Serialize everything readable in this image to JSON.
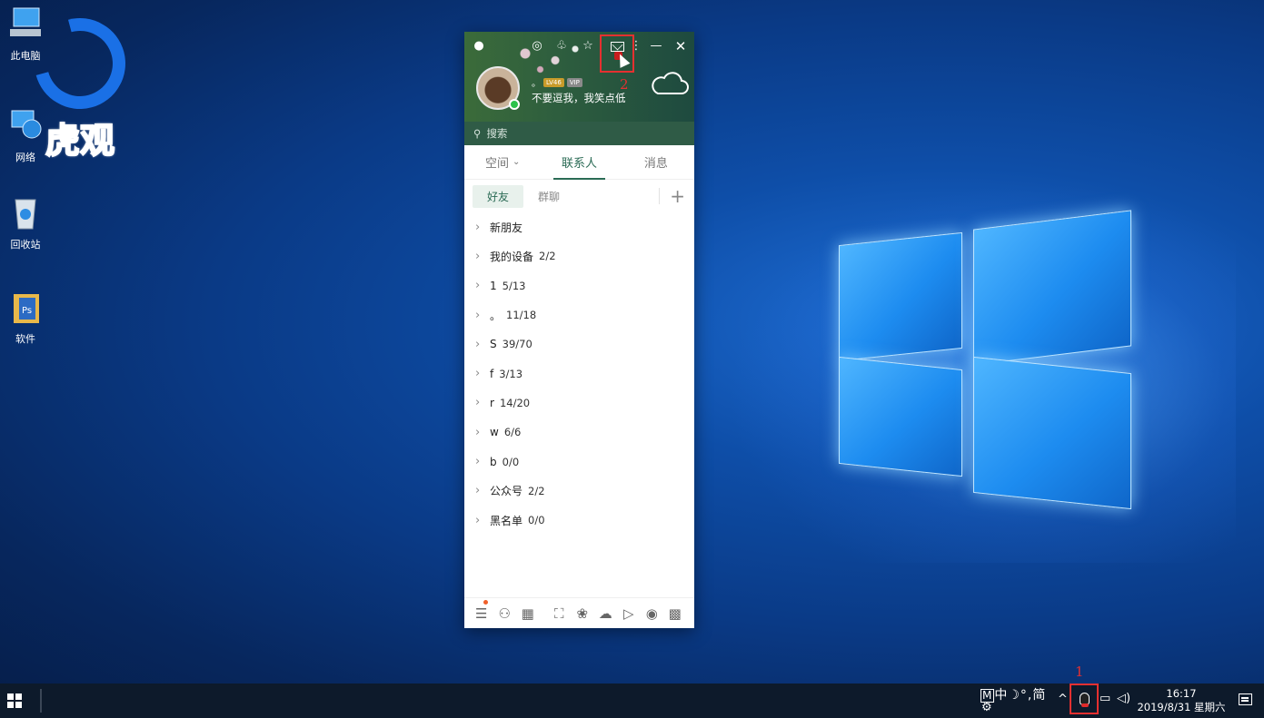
{
  "desktop": {
    "icons": [
      {
        "label": "此电脑"
      },
      {
        "label": "网络"
      },
      {
        "label": "回收站"
      },
      {
        "label": "软件"
      }
    ],
    "watermark": "虎观"
  },
  "qq": {
    "signature": "不要逗我，我笑点低",
    "nickname": "。",
    "level_badge": "LV46",
    "vip_badge": "VIP",
    "search_placeholder": "搜索",
    "tabs": [
      {
        "label": "空间",
        "has_dropdown": true
      },
      {
        "label": "联系人",
        "active": true
      },
      {
        "label": "消息"
      }
    ],
    "subtabs": [
      {
        "label": "好友",
        "active": true
      },
      {
        "label": "群聊"
      }
    ],
    "plus": "+",
    "groups": [
      {
        "name": "新朋友",
        "count": ""
      },
      {
        "name": "我的设备",
        "count": "2/2"
      },
      {
        "name": "1",
        "count": "5/13"
      },
      {
        "name": "。",
        "count": "11/18"
      },
      {
        "name": "S",
        "count": "39/70"
      },
      {
        "name": "f",
        "count": "3/13"
      },
      {
        "name": "r",
        "count": "14/20"
      },
      {
        "name": "w",
        "count": "6/6"
      },
      {
        "name": "b",
        "count": "0/0"
      },
      {
        "name": "公众号",
        "count": "2/2"
      },
      {
        "name": "黑名单",
        "count": "0/0"
      }
    ],
    "annotation_mail": "2"
  },
  "taskbar": {
    "ime": {
      "mode_letter": "M",
      "lang": "中",
      "moon": "☽",
      "punct": "°,",
      "script": "简"
    },
    "annotation_tray": "1",
    "time": "16:17",
    "date": "2019/8/31 星期六"
  },
  "colors": {
    "accent_green": "#2b6b55",
    "annotation_red": "#e53030",
    "taskbar": "#0d1a2b"
  }
}
